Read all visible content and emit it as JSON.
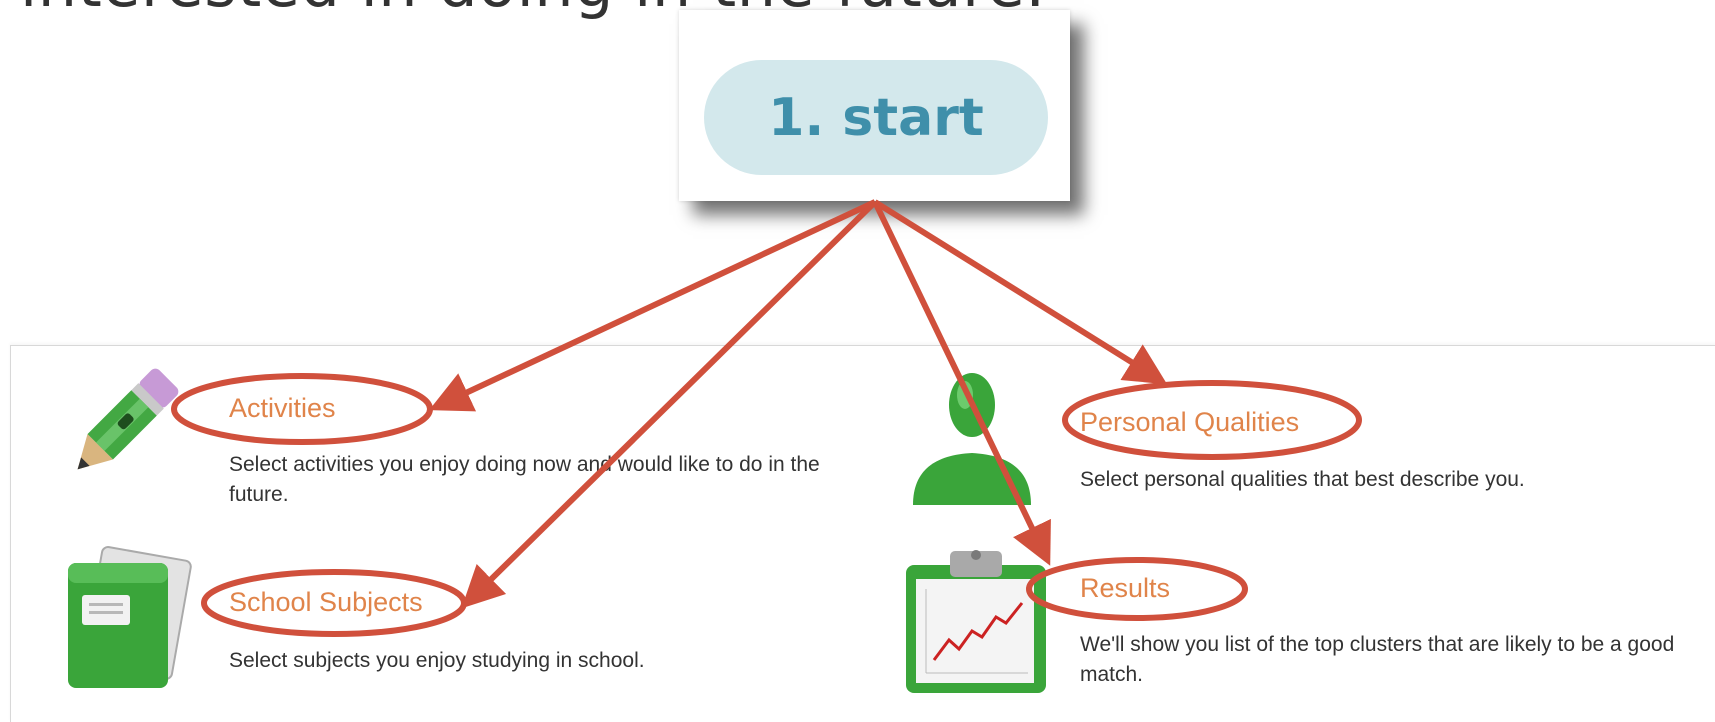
{
  "heading": {
    "text": "interested in doing in the future."
  },
  "start": {
    "label": "1. start"
  },
  "items": [
    {
      "title": "Activities",
      "description": "Select activities you enjoy doing now and would like to do in the future."
    },
    {
      "title": "School Subjects",
      "description": "Select subjects you enjoy studying in school."
    },
    {
      "title": "Personal Qualities",
      "description": "Select personal qualities that best describe you."
    },
    {
      "title": "Results",
      "description": "We'll show you list of the top clusters that are likely to be a good match."
    }
  ],
  "colors": {
    "annotation_red": "#d0503c",
    "link_orange": "#e0844a",
    "pill_bg": "#d3e8ec",
    "pill_text": "#3f8faa",
    "icon_green": "#3aa53a"
  },
  "icons": [
    "pencil-icon",
    "notebook-icon",
    "person-silhouette-icon",
    "clipboard-chart-icon"
  ]
}
